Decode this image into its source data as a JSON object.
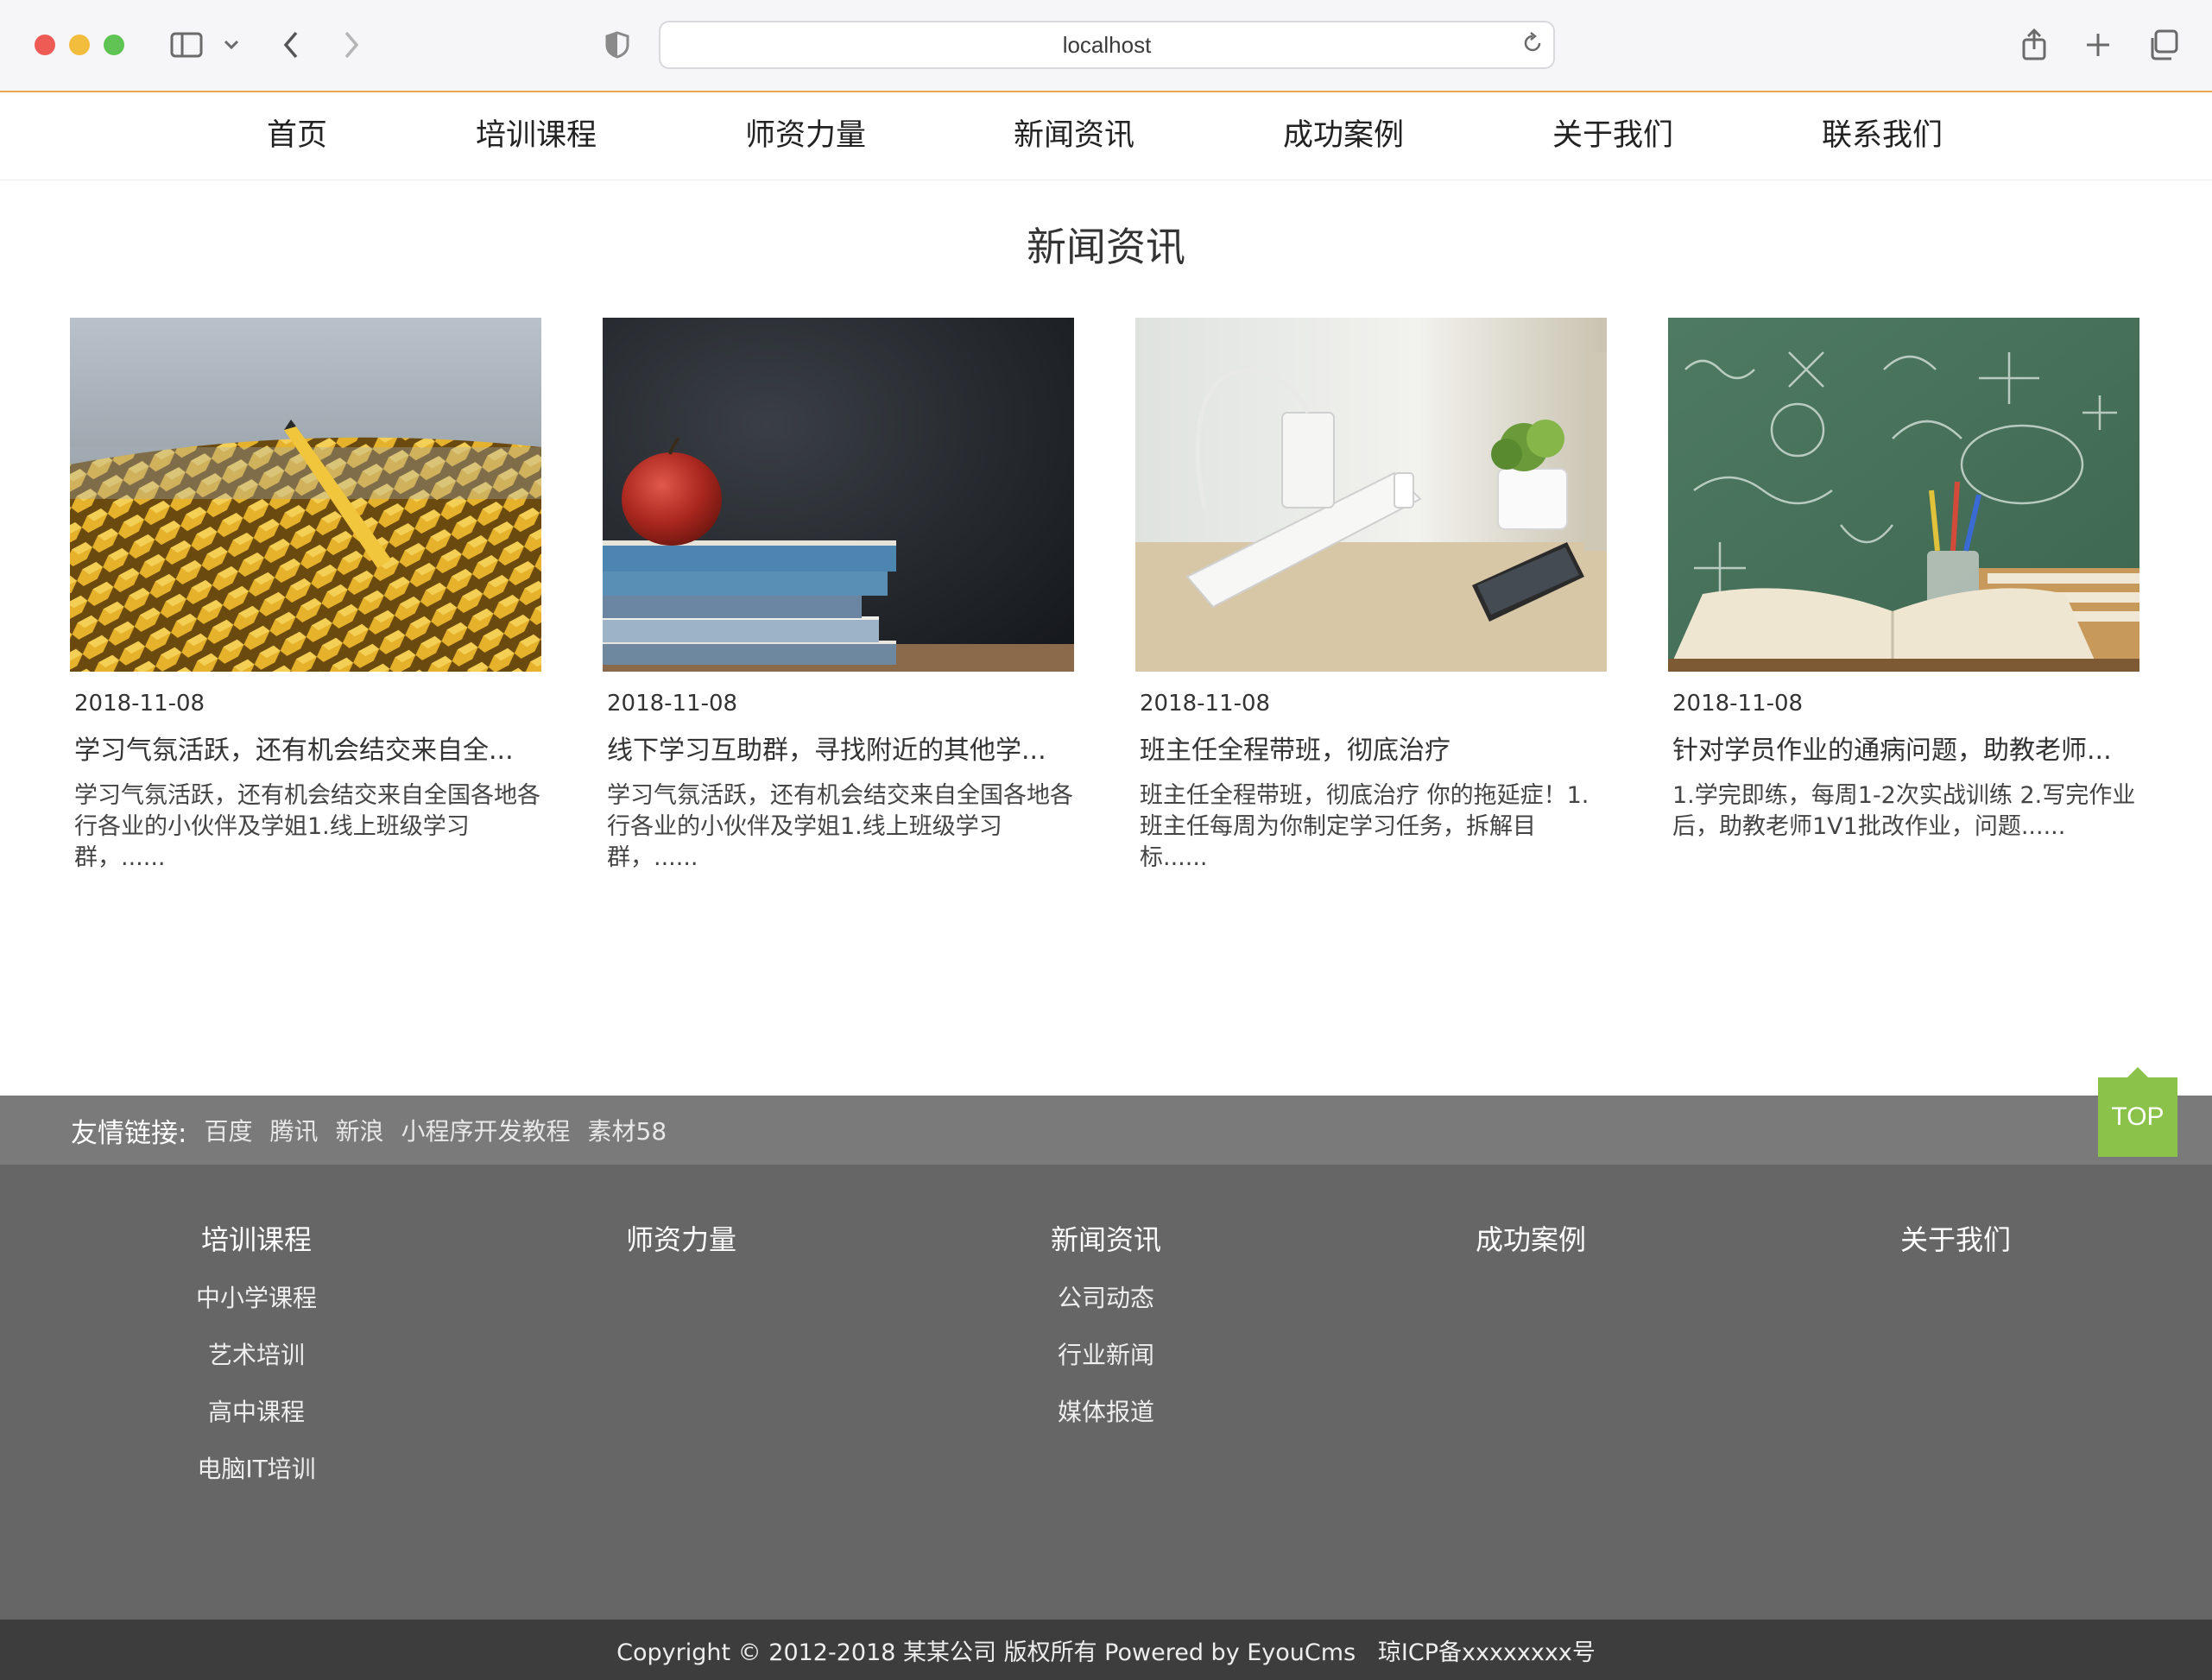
{
  "browser": {
    "url": "localhost"
  },
  "nav": {
    "items": [
      "首页",
      "培训课程",
      "师资力量",
      "新闻资讯",
      "成功案例",
      "关于我们",
      "联系我们"
    ]
  },
  "news": {
    "title": "新闻资讯",
    "cards": [
      {
        "date": "2018-11-08",
        "title": "学习气氛活跃，还有机会结交来自全...",
        "excerpt": "学习气氛活跃，还有机会结交来自全国各地各行各业的小伙伴及学姐1.线上班级学习群，......",
        "image": "pencils-photo"
      },
      {
        "date": "2018-11-08",
        "title": "线下学习互助群，寻找附近的其他学...",
        "excerpt": "学习气氛活跃，还有机会结交来自全国各地各行各业的小伙伴及学姐1.线上班级学习群，......",
        "image": "apple-books-photo"
      },
      {
        "date": "2018-11-08",
        "title": "班主任全程带班，彻底治疗",
        "excerpt": "班主任全程带班，彻底治疗 你的拖延症！1.班主任每周为你制定学习任务，拆解目 标......",
        "image": "desk-charger-photo"
      },
      {
        "date": "2018-11-08",
        "title": "针对学员作业的通病问题，助教老师...",
        "excerpt": "1.学完即练，每周1-2次实战训练 2.写完作业后，助教老师1V1批改作业，问题......",
        "image": "chalkboard-books-photo"
      }
    ]
  },
  "friend_links": {
    "label": "友情链接:",
    "links": [
      "百度",
      "腾讯",
      "新浪",
      "小程序开发教程",
      "素材58"
    ]
  },
  "top_button": "TOP",
  "footer": {
    "columns": [
      {
        "title": "培训课程",
        "links": [
          "中小学课程",
          "艺术培训",
          "高中课程",
          "电脑IT培训"
        ]
      },
      {
        "title": "师资力量",
        "links": []
      },
      {
        "title": "新闻资讯",
        "links": [
          "公司动态",
          "行业新闻",
          "媒体报道"
        ]
      },
      {
        "title": "成功案例",
        "links": []
      },
      {
        "title": "关于我们",
        "links": []
      }
    ],
    "copyright": "Copyright © 2012-2018 某某公司 版权所有 Powered by EyouCms   琼ICP备xxxxxxxx号"
  },
  "colors": {
    "accent_green": "#8bc34a",
    "footer_bg": "#666666",
    "friends_bg": "#7a7a7a",
    "copyright_bg": "#3d3d3d"
  }
}
